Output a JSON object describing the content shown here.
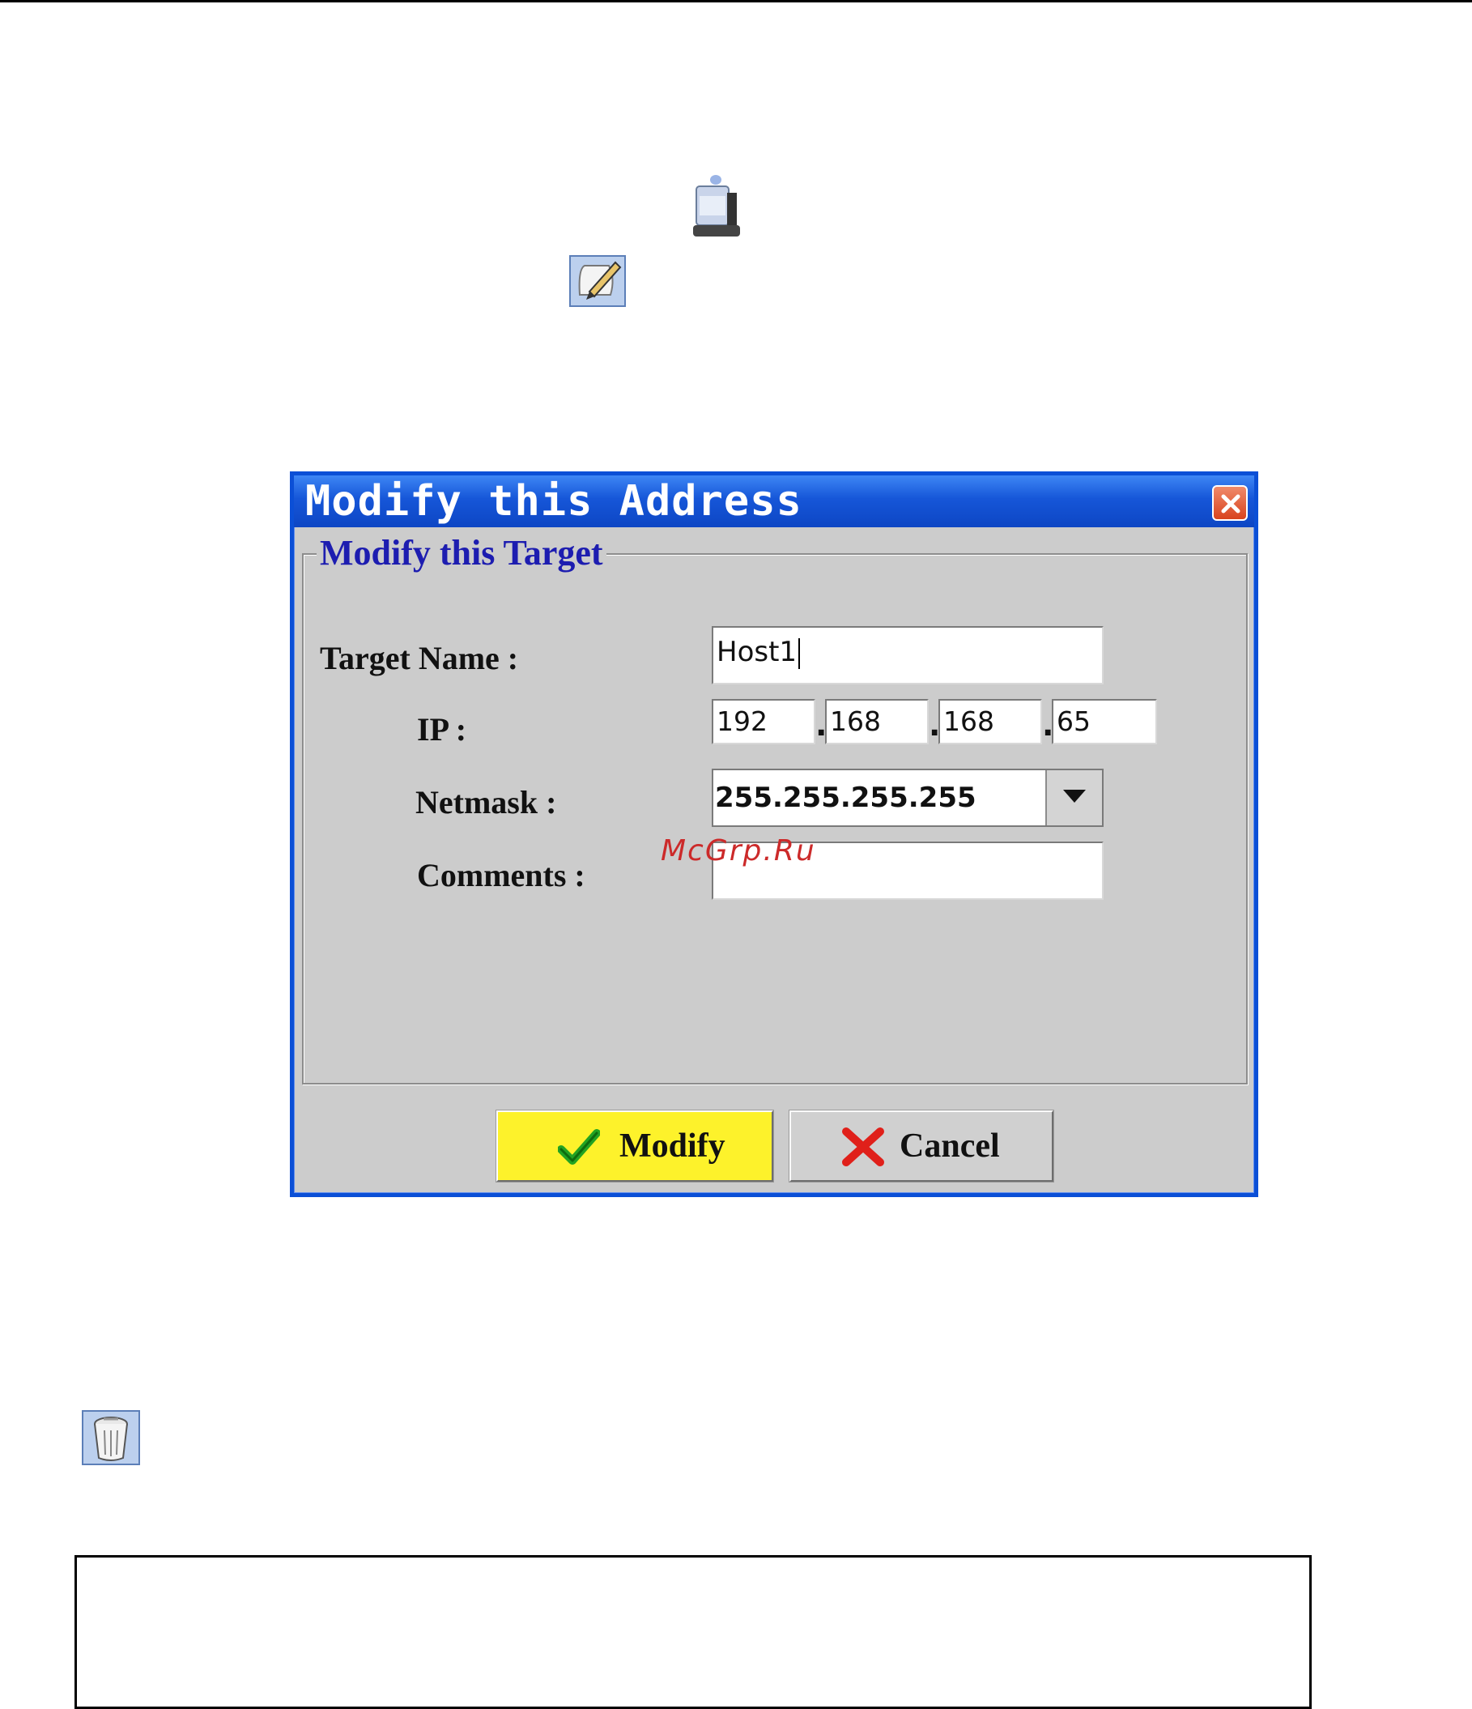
{
  "dialog": {
    "title": "Modify this Address",
    "group_title": "Modify this Target",
    "fields": {
      "target_name_label": "Target Name :",
      "target_name_value": "Host1",
      "ip_label": "IP :",
      "ip_octets": [
        "192",
        "168",
        "168",
        "65"
      ],
      "netmask_label": "Netmask :",
      "netmask_value": "255.255.255.255",
      "comments_label": "Comments :",
      "comments_value": ""
    },
    "buttons": {
      "modify_label": "Modify",
      "cancel_label": "Cancel"
    }
  },
  "watermark": "McGrp.Ru",
  "icons": {
    "server": "server-icon",
    "edit": "edit-icon",
    "trash": "trash-icon",
    "close": "close-icon",
    "check": "check-icon",
    "cancel_x": "x-icon",
    "dropdown": "chevron-down-icon"
  },
  "colors": {
    "titlebar": "#1656d8",
    "dialog_bg": "#cccccc",
    "group_title": "#1d1db0",
    "modify_button": "#fdf22b",
    "cancel_x": "#e0201a",
    "check": "#22a322",
    "watermark": "#cc2a2a"
  }
}
